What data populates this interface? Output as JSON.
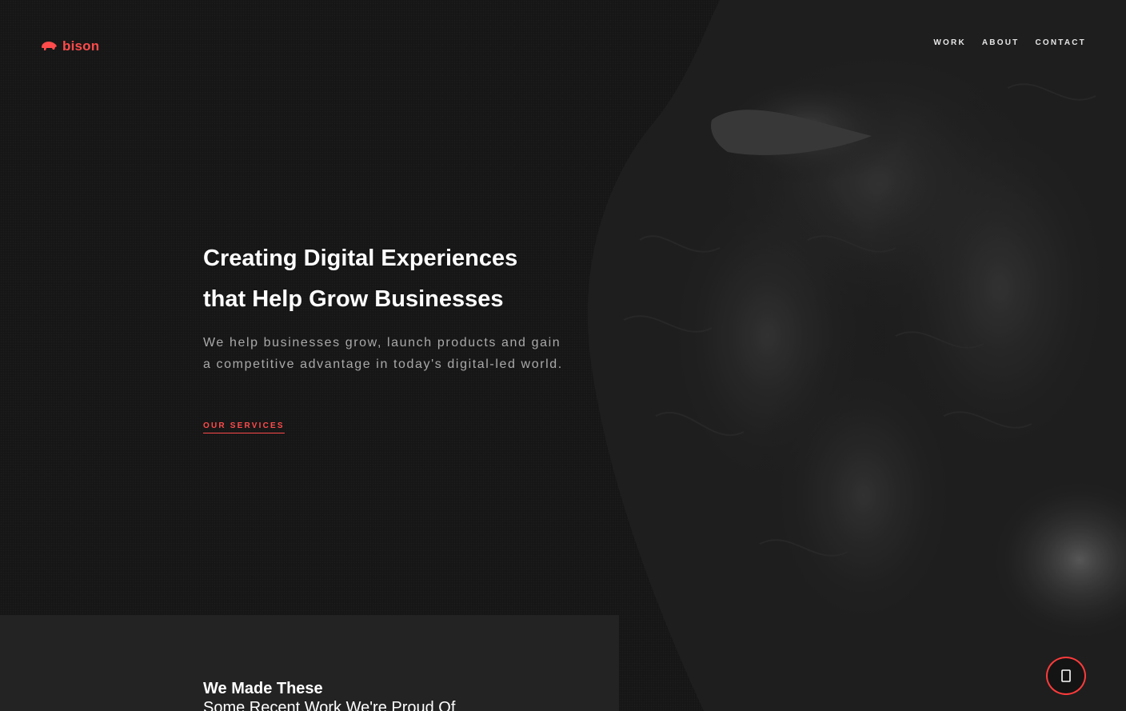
{
  "brand": {
    "name": "bison",
    "accent": "#ff4b4b"
  },
  "nav": {
    "items": [
      "WORK",
      "ABOUT",
      "CONTACT"
    ]
  },
  "hero": {
    "title_line1": "Creating Digital Experiences",
    "title_line2": "that Help Grow Businesses",
    "text": "We help businesses grow, launch products and gain a competitive advantage in today's digital-led world.",
    "cta_label": "OUR SERVICES"
  },
  "work": {
    "title": "We Made These",
    "subtitle": "Some Recent Work We're Proud Of"
  },
  "icons": {
    "logo": "bison-logo-icon",
    "scroll": "arrow-down-icon"
  }
}
